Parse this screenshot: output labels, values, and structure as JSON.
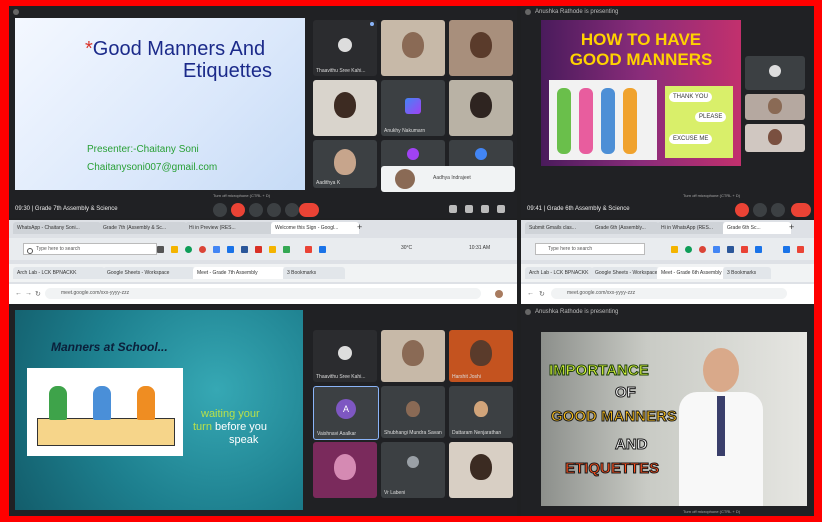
{
  "q1": {
    "slide": {
      "asterisk": "*",
      "title_line1": "Good Manners And",
      "title_line2": "Etiquettes",
      "presenter": "Presenter:-Chaitany Soni",
      "email": "Chaitanysoni007@gmail.com"
    },
    "participants": [
      "Thaavithu Sree Kahi...",
      "",
      "",
      "",
      "Anukhy Nakumarn",
      "",
      "Aadithya K",
      "",
      "",
      "Aadhya Indrajeet"
    ],
    "tooltip": "Turn off microphone (CTRL + D)",
    "meeting_time": "09:30",
    "meeting_title": "Grade 7th Assembly & Science"
  },
  "q2": {
    "presenting_banner": "Anushka Rathode is presenting",
    "slide": {
      "title_line1": "HOW TO HAVE",
      "title_line2": "GOOD MANNERS",
      "bubble1": "THANK YOU",
      "bubble2": "PLEASE",
      "bubble3": "EXCUSE ME"
    },
    "tooltip": "Turn off microphone (CTRL + D)",
    "meeting_time": "09:41",
    "meeting_title": "Grade 6th Assembly & Science"
  },
  "browser1": {
    "tabs": [
      "WhatsApp - Chaitany Soni...",
      "Grade 7th (Assembly & Sc...",
      "Hi in Preview (RES...",
      "Welcome this Sign - Googl..."
    ],
    "new_tab": "+",
    "search_placeholder": "Type here to search",
    "weather": "30°C",
    "clock": "10:31 AM",
    "bookmarks": [
      "Arch Lab - LCK BPNACKK",
      "Google Sheets - Workspace",
      "Meet - Grade 7th Assembly",
      "3 Bookmarks"
    ],
    "address": "meet.google.com/xxx-yyyy-zzz"
  },
  "browser2": {
    "tabs": [
      "Submit Gmails clas...",
      "Grade 6th (Assembly...",
      "Hi in WhatsApp (RES...",
      "Grade 6th Sc..."
    ],
    "new_tab": "+",
    "search_placeholder": "Type here to search",
    "bookmarks": [
      "Arch Lab - LCK BPNACKK",
      "Google Sheets - Workspace",
      "Meet - Grade 6th Assembly",
      "3 Bookmarks"
    ],
    "address": "meet.google.com/xxx-yyyy-zzz"
  },
  "q3": {
    "slide": {
      "title": "Manners at School...",
      "caption_green1": "waiting your",
      "caption_green2": "turn",
      "caption_white1": "before you",
      "caption_white2": "speak"
    },
    "participants": [
      "Thaavithu Sree Kahi...",
      "",
      "Harshit Joshi",
      "Vaishnavi Asalkar",
      "Shubhangi Mundra Savan",
      "Dattaram Nenjarathan",
      "",
      "Vr Labeni",
      ""
    ],
    "avatar_letter": "A"
  },
  "q4": {
    "presenting_banner": "Anushka Rathode is presenting",
    "slide": {
      "line1": "IMPORTANCE",
      "line2": "OF",
      "line3": "GOOD MANNERS",
      "line4": "AND",
      "line5": "ETIQUETTES"
    },
    "tooltip": "Turn off microphone (CTRL + D)"
  },
  "colors": {
    "border_red": "#ff0000",
    "meet_dark": "#202124",
    "tile_grey": "#3c4043",
    "end_call_red": "#ea4335",
    "slide_green": "#7ab317"
  }
}
